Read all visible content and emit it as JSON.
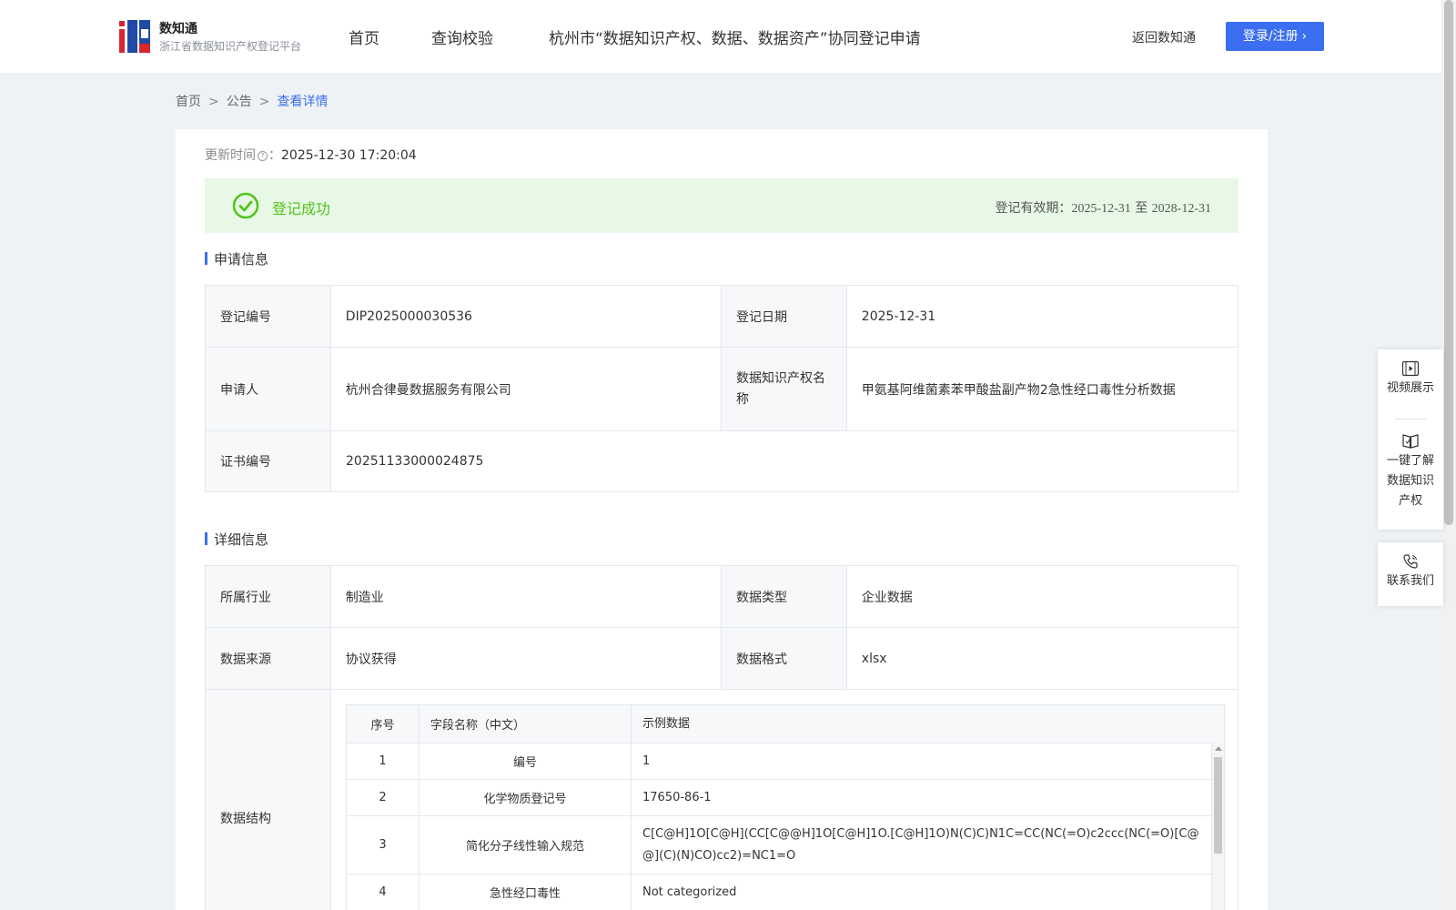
{
  "header": {
    "brand_name": "数知通",
    "brand_sub": "浙江省数据知识产权登记平台",
    "nav": [
      "首页",
      "查询校验",
      "杭州市“数据知识产权、数据、数据资产”协同登记申请"
    ],
    "back_link": "返回数知通",
    "login_label": "登录/注册"
  },
  "breadcrumb": {
    "items": [
      "首页",
      "公告",
      "查看详情"
    ],
    "separator": ">"
  },
  "update": {
    "label": "更新时间",
    "colon": "：",
    "value": "2025-12-30 17:20:04"
  },
  "status": {
    "text": "登记成功",
    "validity_label": "登记有效期：",
    "validity_start": "2025-12-31",
    "validity_to": "至",
    "validity_end": "2028-12-31",
    "color": "#52c41a"
  },
  "apply_info": {
    "title": "申请信息",
    "reg_no_label": "登记编号",
    "reg_no": "DIP2025000030536",
    "reg_date_label": "登记日期",
    "reg_date": "2025-12-31",
    "applicant_label": "申请人",
    "applicant": "杭州合律曼数据服务有限公司",
    "ip_name_label": "数据知识产权名称",
    "ip_name": "甲氨基阿维菌素苯甲酸盐副产物2急性经口毒性分析数据",
    "cert_no_label": "证书编号",
    "cert_no": "20251133000024875"
  },
  "detail_info": {
    "title": "详细信息",
    "industry_label": "所属行业",
    "industry": "制造业",
    "data_type_label": "数据类型",
    "data_type": "企业数据",
    "source_label": "数据来源",
    "source": "协议获得",
    "format_label": "数据格式",
    "format": "xlsx",
    "structure_label": "数据结构",
    "structure_headers": [
      "序号",
      "字段名称（中文）",
      "示例数据"
    ],
    "structure_rows": [
      [
        "1",
        "编号",
        "1"
      ],
      [
        "2",
        "化学物质登记号",
        "17650-86-1"
      ],
      [
        "3",
        "简化分子线性输入规范",
        "C[C@H]1O[C@H](CC[C@@H]1O[C@H]1O.[C@H]1O)N(C)C)N1C=CC(NC(=O)c2ccc(NC(=O)[C@@](C)(N)CO)cc2)=NC1=O"
      ],
      [
        "4",
        "急性经口毒性",
        "Not categorized"
      ]
    ]
  },
  "float_panel": {
    "video": "视频展示",
    "learn": "一键了解数据知识产权",
    "contact": "联系我们"
  },
  "colors": {
    "accent": "#3b6ef0",
    "success_bg": "#e8f8e6"
  }
}
